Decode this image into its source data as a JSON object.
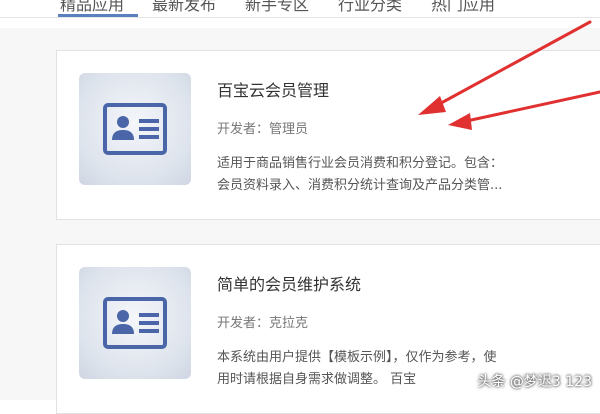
{
  "tabs": [
    {
      "label": "精品应用",
      "active": true
    },
    {
      "label": "最新发布",
      "active": false
    },
    {
      "label": "新手专区",
      "active": false
    },
    {
      "label": "行业分类",
      "active": false
    },
    {
      "label": "热门应用",
      "active": false
    }
  ],
  "apps": [
    {
      "icon": "id-card-icon",
      "title": "百宝云会员管理",
      "developer": "开发者：管理员",
      "description_lines": [
        "适用于商品销售行业会员消费和积分登记。包含：",
        "会员资料录入、消费积分统计查询及产品分类管..."
      ]
    },
    {
      "icon": "id-card-icon",
      "title": "简单的会员维护系统",
      "developer": "开发者：克拉克",
      "description_lines": [
        "本系统由用户提供【模板示例】，仅作为参考，使",
        "用时请根据自身需求做调整。 百宝"
      ]
    }
  ],
  "watermark": "头条 @梦迟3 123",
  "colors": {
    "accent": "#5b7fbf",
    "icon": "#4a66a8",
    "arrow": "#e03030"
  }
}
